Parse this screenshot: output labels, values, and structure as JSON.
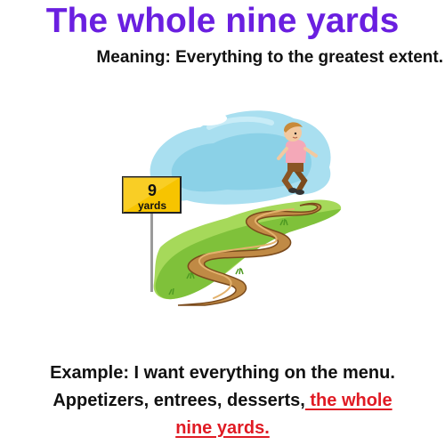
{
  "title": "The whole nine yards",
  "meaning": "Meaning: Everything to the greatest extent.",
  "sign": {
    "number": "9",
    "unit": "yards"
  },
  "example": {
    "line1": "Example: I want everything on the menu.",
    "line2_prefix": "Appetizers, entrees, desserts,",
    "line2_highlight": " the whole",
    "line3_highlight": "nine yards."
  },
  "colors": {
    "title": "#6a1fe0",
    "highlight": "#e01b24",
    "sign_yellow": "#f7c400",
    "grass": "#8fcf3c",
    "path": "#a56a2c",
    "sky": "#8fd3e8"
  },
  "icons": [
    "signpost-icon",
    "running-boy-icon",
    "cloud-icon",
    "winding-path-icon"
  ]
}
